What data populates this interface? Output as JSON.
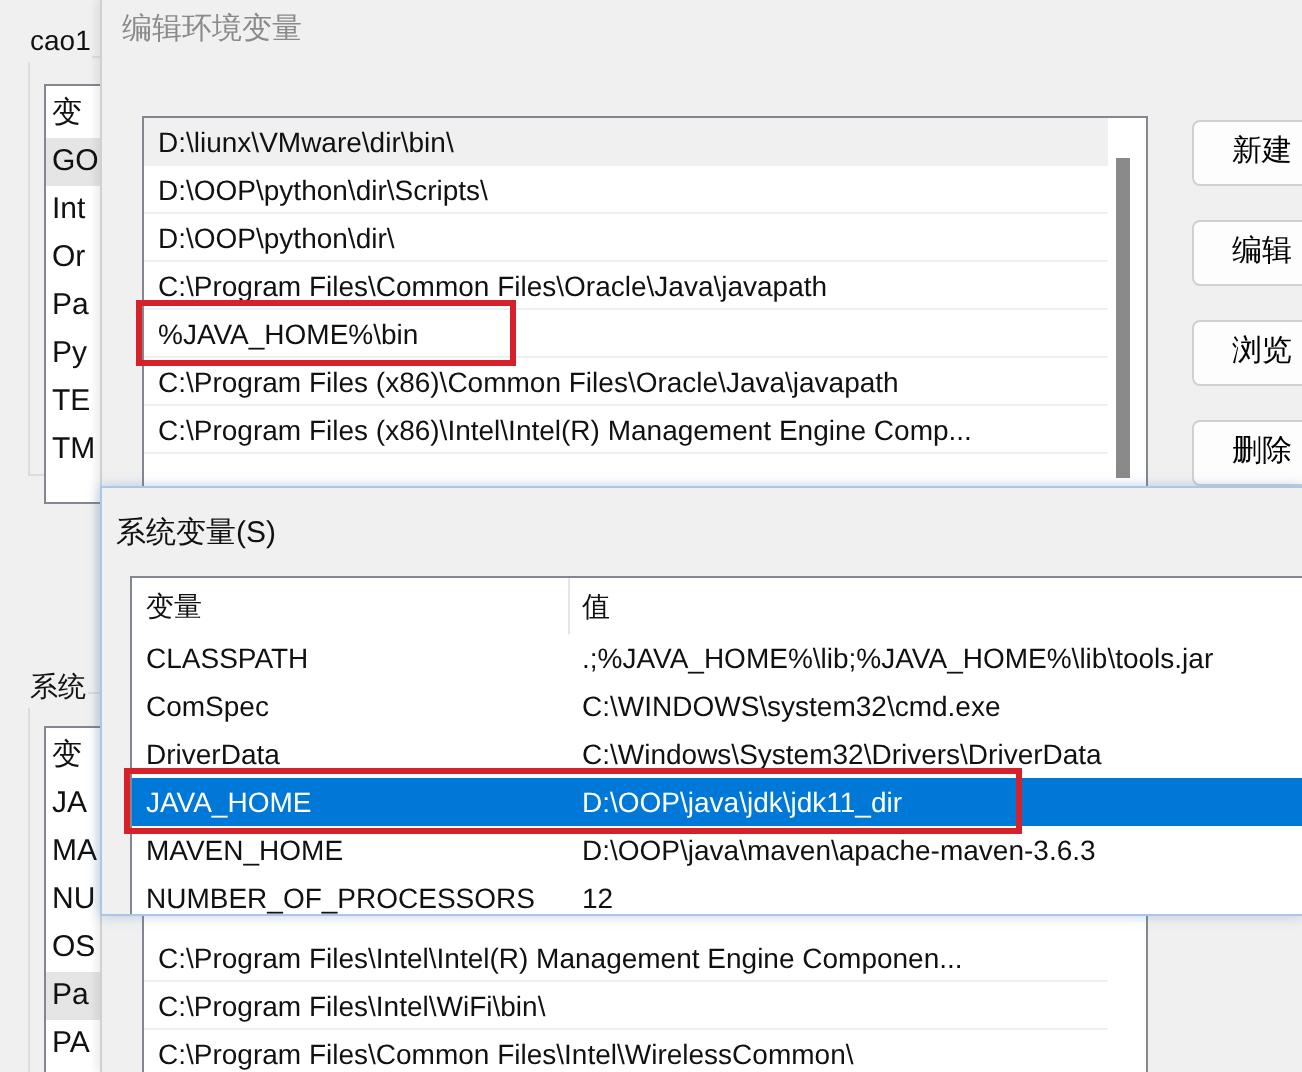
{
  "back_window": {
    "user_group_label": "cao1",
    "user_rows": [
      {
        "text": "变",
        "selected": false
      },
      {
        "text": "GO",
        "selected": true
      },
      {
        "text": "Int",
        "selected": false
      },
      {
        "text": "Or",
        "selected": false
      },
      {
        "text": "Pa",
        "selected": false
      },
      {
        "text": "Py",
        "selected": false
      },
      {
        "text": "TE",
        "selected": false
      },
      {
        "text": "TM",
        "selected": false
      }
    ],
    "system_group_label": "系统",
    "system_rows": [
      {
        "text": "变",
        "selected": false
      },
      {
        "text": "JA",
        "selected": false
      },
      {
        "text": "MA",
        "selected": false
      },
      {
        "text": "NU",
        "selected": false
      },
      {
        "text": "OS",
        "selected": false
      },
      {
        "text": "Pa",
        "selected": true
      },
      {
        "text": "PA",
        "selected": false
      }
    ]
  },
  "edit_dialog": {
    "title": "编辑环境变量",
    "rows_top": [
      {
        "text": "D:\\liunx\\VMware\\dir\\bin\\",
        "selected": true,
        "highlighted": false
      },
      {
        "text": "D:\\OOP\\python\\dir\\Scripts\\",
        "selected": false,
        "highlighted": false
      },
      {
        "text": "D:\\OOP\\python\\dir\\",
        "selected": false,
        "highlighted": false
      },
      {
        "text": "C:\\Program Files\\Common Files\\Oracle\\Java\\javapath",
        "selected": false,
        "highlighted": false
      },
      {
        "text": "%JAVA_HOME%\\bin",
        "selected": false,
        "highlighted": true
      },
      {
        "text": "C:\\Program Files (x86)\\Common Files\\Oracle\\Java\\javapath",
        "selected": false,
        "highlighted": false
      },
      {
        "text": "C:\\Program Files (x86)\\Intel\\Intel(R) Management Engine Comp...",
        "selected": false,
        "highlighted": false
      }
    ],
    "rows_bottom": [
      {
        "text": "C:\\Program Files\\Intel\\Intel(R) Management Engine Componen...",
        "selected": false,
        "highlighted": false
      },
      {
        "text": "C:\\Program Files\\Intel\\WiFi\\bin\\",
        "selected": false,
        "highlighted": false
      },
      {
        "text": "C:\\Program Files\\Common Files\\Intel\\WirelessCommon\\",
        "selected": false,
        "highlighted": false
      }
    ],
    "buttons": [
      "新建",
      "编辑",
      "浏览",
      "删除"
    ]
  },
  "system_variables": {
    "title": "系统变量(S)",
    "columns": [
      "变量",
      "值"
    ],
    "rows": [
      {
        "name": "CLASSPATH",
        "value": ".;%JAVA_HOME%\\lib;%JAVA_HOME%\\lib\\tools.jar",
        "selected": false,
        "highlighted": false
      },
      {
        "name": "ComSpec",
        "value": "C:\\WINDOWS\\system32\\cmd.exe",
        "selected": false,
        "highlighted": false
      },
      {
        "name": "DriverData",
        "value": "C:\\Windows\\System32\\Drivers\\DriverData",
        "selected": false,
        "highlighted": false
      },
      {
        "name": "JAVA_HOME",
        "value": "D:\\OOP\\java\\jdk\\jdk11_dir",
        "selected": true,
        "highlighted": true
      },
      {
        "name": "MAVEN_HOME",
        "value": "D:\\OOP\\java\\maven\\apache-maven-3.6.3",
        "selected": false,
        "highlighted": false
      },
      {
        "name": "NUMBER_OF_PROCESSORS",
        "value": "12",
        "selected": false,
        "highlighted": false
      }
    ]
  }
}
